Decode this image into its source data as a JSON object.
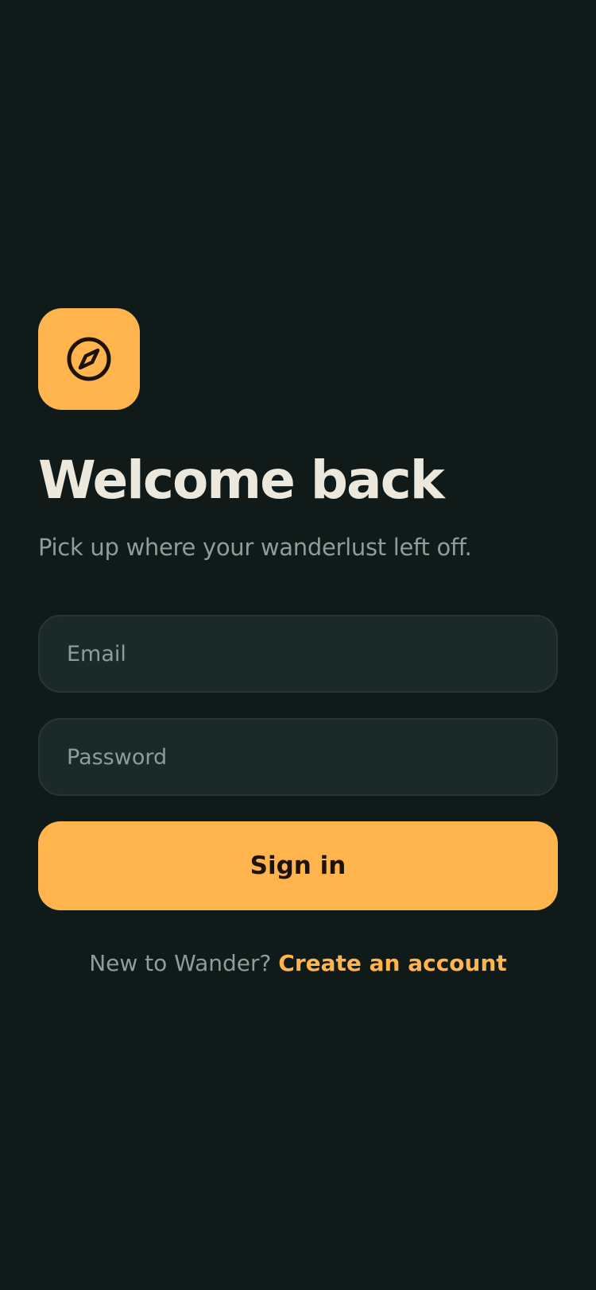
{
  "app": {
    "logo_icon": "compass-icon",
    "accent_color": "#ffb44d"
  },
  "header": {
    "title": "Welcome back",
    "subtitle": "Pick up where your wanderlust left off."
  },
  "form": {
    "email": {
      "placeholder": "Email",
      "value": ""
    },
    "password": {
      "placeholder": "Password",
      "value": ""
    },
    "submit_label": "Sign in"
  },
  "footer": {
    "prompt": "New to Wander?",
    "link_label": "Create an account"
  }
}
